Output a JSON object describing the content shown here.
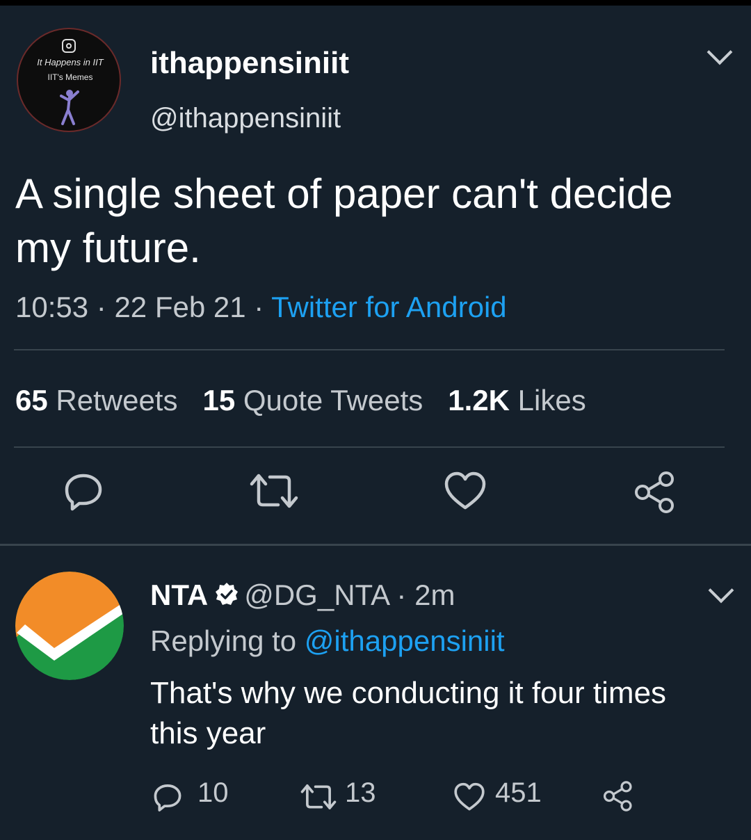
{
  "tweet": {
    "avatar_text_line1": "It Happens in IIT",
    "avatar_text_line2": "IIT's Memes",
    "display_name": "ithappensiniit",
    "handle": "@ithappensiniit",
    "text": "A single sheet of paper can't decide my future.",
    "time": "10:53",
    "date": "22 Feb 21",
    "source": "Twitter for Android",
    "retweets_count": "65",
    "retweets_label": "Retweets",
    "quotes_count": "15",
    "quotes_label": "Quote Tweets",
    "likes_count": "1.2K",
    "likes_label": "Likes"
  },
  "reply": {
    "display_name": "NTA",
    "handle": "@DG_NTA",
    "age": "2m",
    "replying_prefix": "Replying to",
    "replying_to": "@ithappensiniit",
    "text": "That's why we conducting it four times this year",
    "reply_count": "10",
    "retweet_count": "13",
    "like_count": "451"
  },
  "icons": [
    "chevron-down-icon",
    "reply-icon",
    "retweet-icon",
    "like-icon",
    "share-icon",
    "verified-badge-icon",
    "instagram-icon"
  ],
  "colors": {
    "background": "#15202b",
    "link": "#1da1f2",
    "muted": "#c4c9ce",
    "divider": "#38444d",
    "nta_orange": "#f28c28",
    "nta_green": "#1e9a45"
  }
}
